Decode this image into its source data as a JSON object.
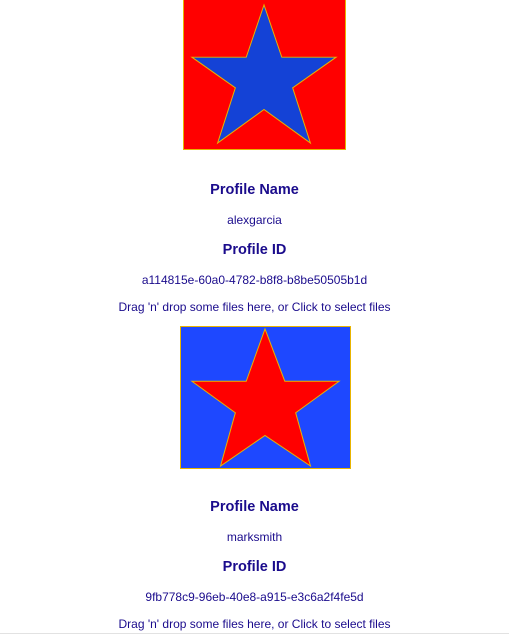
{
  "profiles": [
    {
      "avatar": {
        "icon": "star-icon",
        "background_color": "#ff0000",
        "star_color": "#1442d6",
        "outline_color": "#e8b400"
      },
      "name_heading": "Profile Name",
      "name": "alexgarcia",
      "id_heading": "Profile ID",
      "id": "a114815e-60a0-4782-b8f8-b8be50505b1d",
      "dropzone_text": "Drag 'n' drop some files here, or Click to select files"
    },
    {
      "avatar": {
        "icon": "star-icon",
        "background_color": "#1e48ff",
        "star_color": "#ff0000",
        "outline_color": "#e8b400"
      },
      "name_heading": "Profile Name",
      "name": "marksmith",
      "id_heading": "Profile ID",
      "id": "9fb778c9-96eb-40e8-a915-e3c6a2f4fe5d",
      "dropzone_text": "Drag 'n' drop some files here, or Click to select files"
    }
  ]
}
